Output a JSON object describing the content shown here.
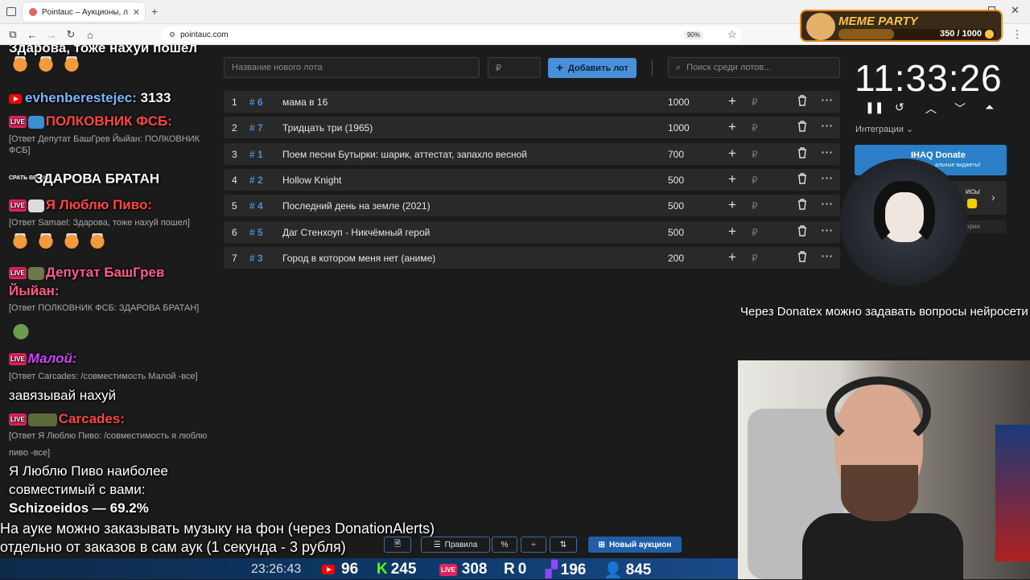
{
  "browser": {
    "tab_title": "Pointauc – Аукционы, лотереи",
    "url": "pointauc.com",
    "zoom": "90%"
  },
  "chat": {
    "lines": [
      {
        "kind": "text",
        "text": "Здарова, тоже нахуй пошел"
      },
      {
        "kind": "user",
        "platform": "youtube",
        "name": "evhenberestejec:",
        "name_color": "#7fb3ff",
        "message": "3133"
      },
      {
        "kind": "user",
        "platform": "live",
        "name": "ПОЛКОВНИК ФСБ:",
        "name_color": "#ff4545"
      },
      {
        "kind": "reply",
        "text": "[Ответ Депутат БашГрев Йыйан: ПОЛКОВНИК ФСБ]"
      },
      {
        "kind": "text",
        "text": "ЗДАРОВА БРАТАН"
      },
      {
        "kind": "user",
        "platform": "live",
        "name": "Я Люблю Пиво:",
        "name_color": "#ff4545"
      },
      {
        "kind": "reply",
        "text": "[Ответ Samael: Здарова, тоже нахуй пошел]"
      },
      {
        "kind": "user",
        "platform": "live",
        "name": "Депутат БашГрев",
        "name_color": "#ff5a8a"
      },
      {
        "kind": "text",
        "text": "Йыйан:",
        "color": "#ff5a8a"
      },
      {
        "kind": "reply",
        "text": "[Ответ ПОЛКОВНИК ФСБ: ЗДАРОВА БРАТАН]"
      },
      {
        "kind": "user",
        "platform": "live",
        "name": "Малой:",
        "name_color": "#d040ff"
      },
      {
        "kind": "reply",
        "text": "[Ответ Carcades: /совместимость Малой -все]"
      },
      {
        "kind": "text",
        "text": "завязывай нахуй"
      },
      {
        "kind": "user",
        "platform": "live",
        "name": "Carcades:",
        "name_color": "#ff4545"
      },
      {
        "kind": "reply",
        "text": "[Ответ Я Люблю Пиво: /совместимость я люблю"
      },
      {
        "kind": "reply",
        "text": "пиво -все]"
      },
      {
        "kind": "text",
        "text": "Я Люблю Пиво наиболее"
      },
      {
        "kind": "text",
        "text": "совместимый с вами:"
      },
      {
        "kind": "text",
        "text": "Schizoeidos — 69.2%"
      }
    ],
    "sprat_label": "СРАТЬ ВЕЧНО"
  },
  "auction": {
    "new_lot_placeholder": "Название нового лота",
    "amount_placeholder": "₽",
    "add_button": "Добавить лот",
    "search_placeholder": "Поиск среди лотов...",
    "lots": [
      {
        "pos": "1",
        "id": "# 6",
        "name": "мама в 16",
        "amount": "1000"
      },
      {
        "pos": "2",
        "id": "# 7",
        "name": "Тридцать три (1965)",
        "amount": "1000"
      },
      {
        "pos": "3",
        "id": "# 1",
        "name": "Поем песни Бутырки: шарик, аттестат, запахло весной",
        "amount": "700"
      },
      {
        "pos": "4",
        "id": "# 2",
        "name": "Hollow Knight",
        "amount": "500"
      },
      {
        "pos": "5",
        "id": "# 4",
        "name": "Последний день на земле (2021)",
        "amount": "500"
      },
      {
        "pos": "6",
        "id": "# 5",
        "name": "Даг Стенхоуп - Никчёмный герой",
        "amount": "500"
      },
      {
        "pos": "7",
        "id": "# 3",
        "name": "Город в котором меня нет (аниме)",
        "amount": "200"
      }
    ],
    "bottom": {
      "rules": "Правила",
      "new_auction": "Новый аукцион"
    }
  },
  "timer": {
    "value": "11:33:26",
    "integrations": "Интеграции",
    "donate_title": "IHAQ Donate",
    "donate_sub": "альные виджеты!",
    "panel2_text": "исы",
    "panel3_text": "ории"
  },
  "meme_party": {
    "title": "MEME PARTY",
    "progress": "350 / 1000",
    "progress_fraction": 0.35
  },
  "subtitle": "Через Donatex можно задавать вопросы нейросети",
  "announcement": {
    "line1": "На ауке можно заказывать музыку на фон (через DonationAlerts)",
    "line2": "отдельно от заказов в сам аук (1 секунда - 3 рубля)"
  },
  "ticker": {
    "clock": "23:26:43",
    "youtube": "96",
    "kick": "245",
    "live": "308",
    "r": "0",
    "twitch": "196",
    "viewers": "845"
  }
}
